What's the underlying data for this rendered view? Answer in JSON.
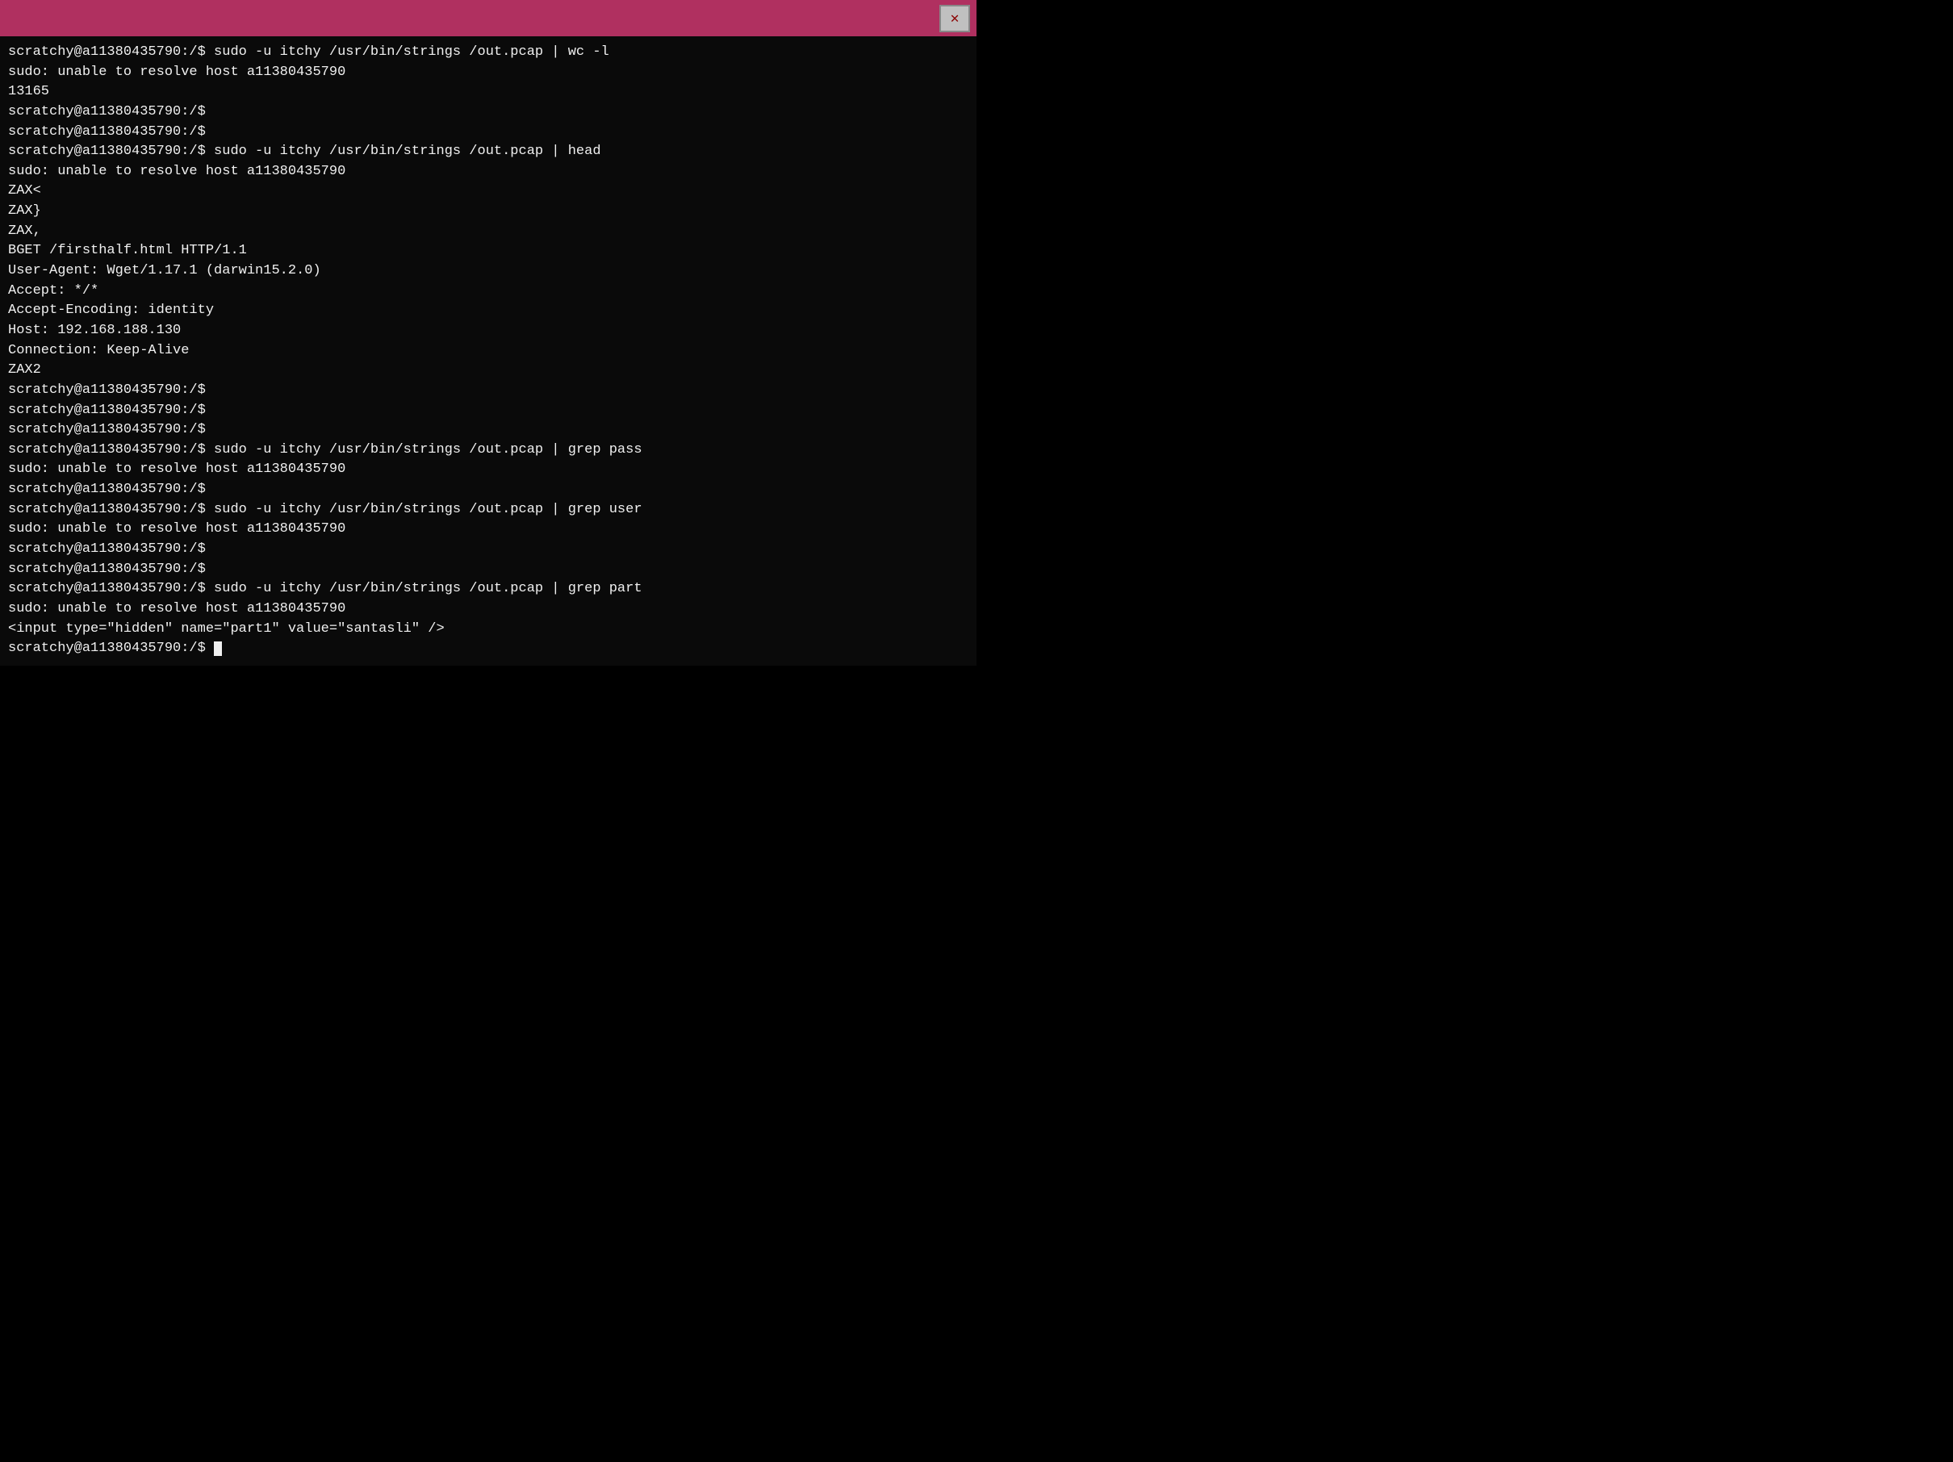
{
  "titleBar": {
    "closeButton": "✕"
  },
  "terminal": {
    "lines": [
      "scratchy@a11380435790:/$ sudo -u itchy /usr/bin/strings /out.pcap | wc -l",
      "sudo: unable to resolve host a11380435790",
      "13165",
      "scratchy@a11380435790:/$",
      "scratchy@a11380435790:/$",
      "scratchy@a11380435790:/$ sudo -u itchy /usr/bin/strings /out.pcap | head",
      "sudo: unable to resolve host a11380435790",
      "ZAX<",
      "ZAX}",
      "ZAX,",
      "BGET /firsthalf.html HTTP/1.1",
      "User-Agent: Wget/1.17.1 (darwin15.2.0)",
      "Accept: */*",
      "Accept-Encoding: identity",
      "Host: 192.168.188.130",
      "Connection: Keep-Alive",
      "ZAX2",
      "scratchy@a11380435790:/$",
      "scratchy@a11380435790:/$",
      "scratchy@a11380435790:/$",
      "scratchy@a11380435790:/$ sudo -u itchy /usr/bin/strings /out.pcap | grep pass",
      "sudo: unable to resolve host a11380435790",
      "scratchy@a11380435790:/$",
      "scratchy@a11380435790:/$ sudo -u itchy /usr/bin/strings /out.pcap | grep user",
      "sudo: unable to resolve host a11380435790",
      "scratchy@a11380435790:/$",
      "scratchy@a11380435790:/$",
      "scratchy@a11380435790:/$ sudo -u itchy /usr/bin/strings /out.pcap | grep part",
      "sudo: unable to resolve host a11380435790",
      "<input type=\"hidden\" name=\"part1\" value=\"santasli\" />",
      "scratchy@a11380435790:/$ "
    ]
  }
}
